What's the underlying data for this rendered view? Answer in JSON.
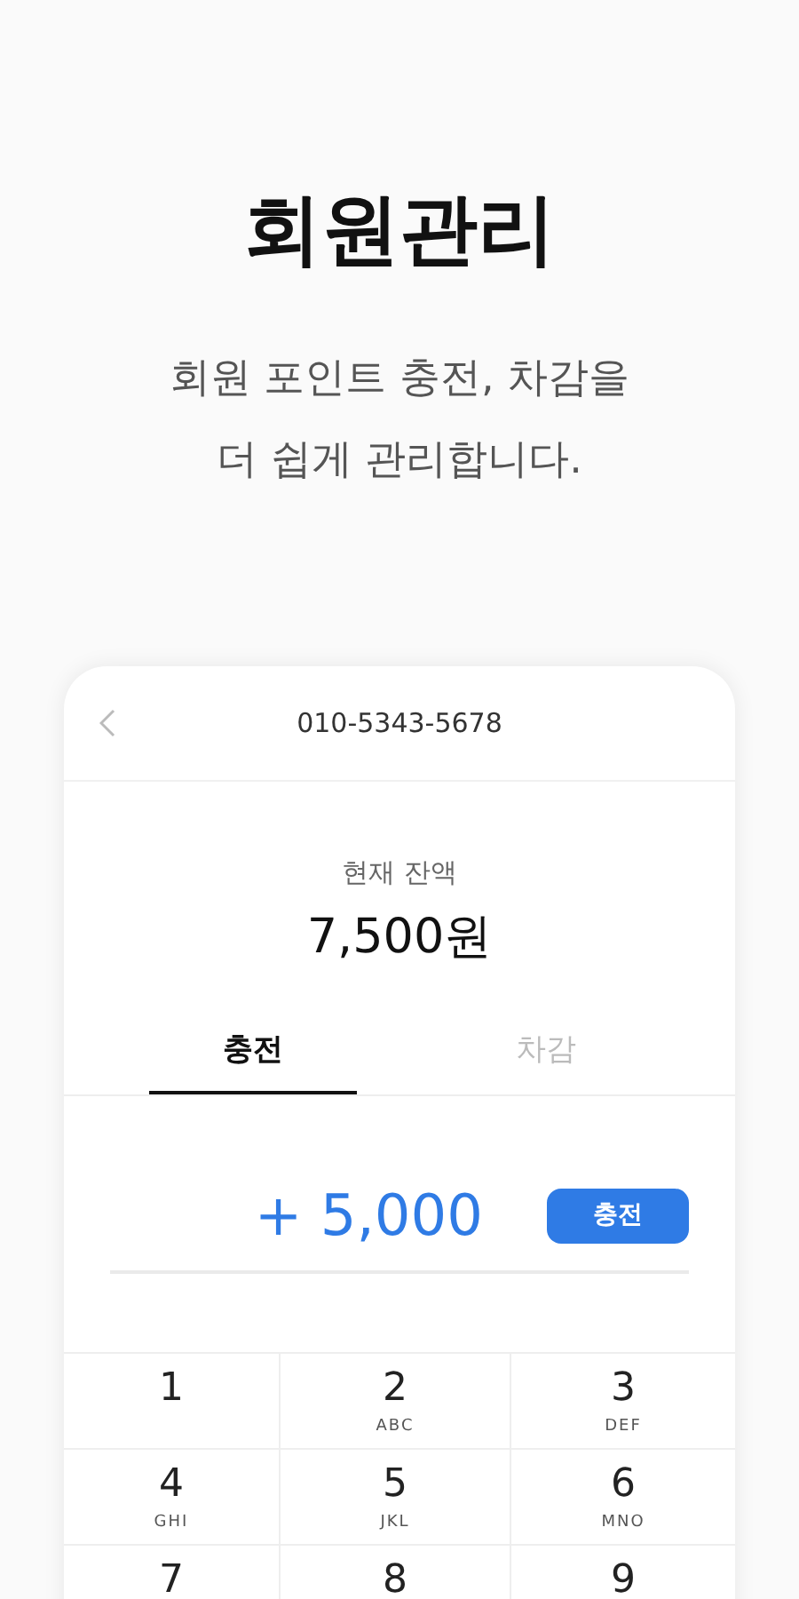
{
  "headline": "회원관리",
  "subtitle": [
    "회원 포인트 충전, 차감을",
    "더 쉽게 관리합니다."
  ],
  "card": {
    "phone": "010-5343-5678",
    "balance_label": "현재 잔액",
    "balance": "7,500원",
    "tabs": [
      {
        "label": "충전",
        "selected": true
      },
      {
        "label": "차감",
        "selected": false
      }
    ],
    "amount": "+ 5,000",
    "action_button": "충전",
    "keys": [
      {
        "digit": "1"
      },
      {
        "digit": "2",
        "letters": "ABC"
      },
      {
        "digit": "3",
        "letters": "DEF"
      },
      {
        "digit": "4",
        "letters": "GHI"
      },
      {
        "digit": "5",
        "letters": "JKL"
      },
      {
        "digit": "6",
        "letters": "MNO"
      },
      {
        "digit": "7"
      },
      {
        "digit": "8"
      },
      {
        "digit": "9"
      }
    ]
  }
}
